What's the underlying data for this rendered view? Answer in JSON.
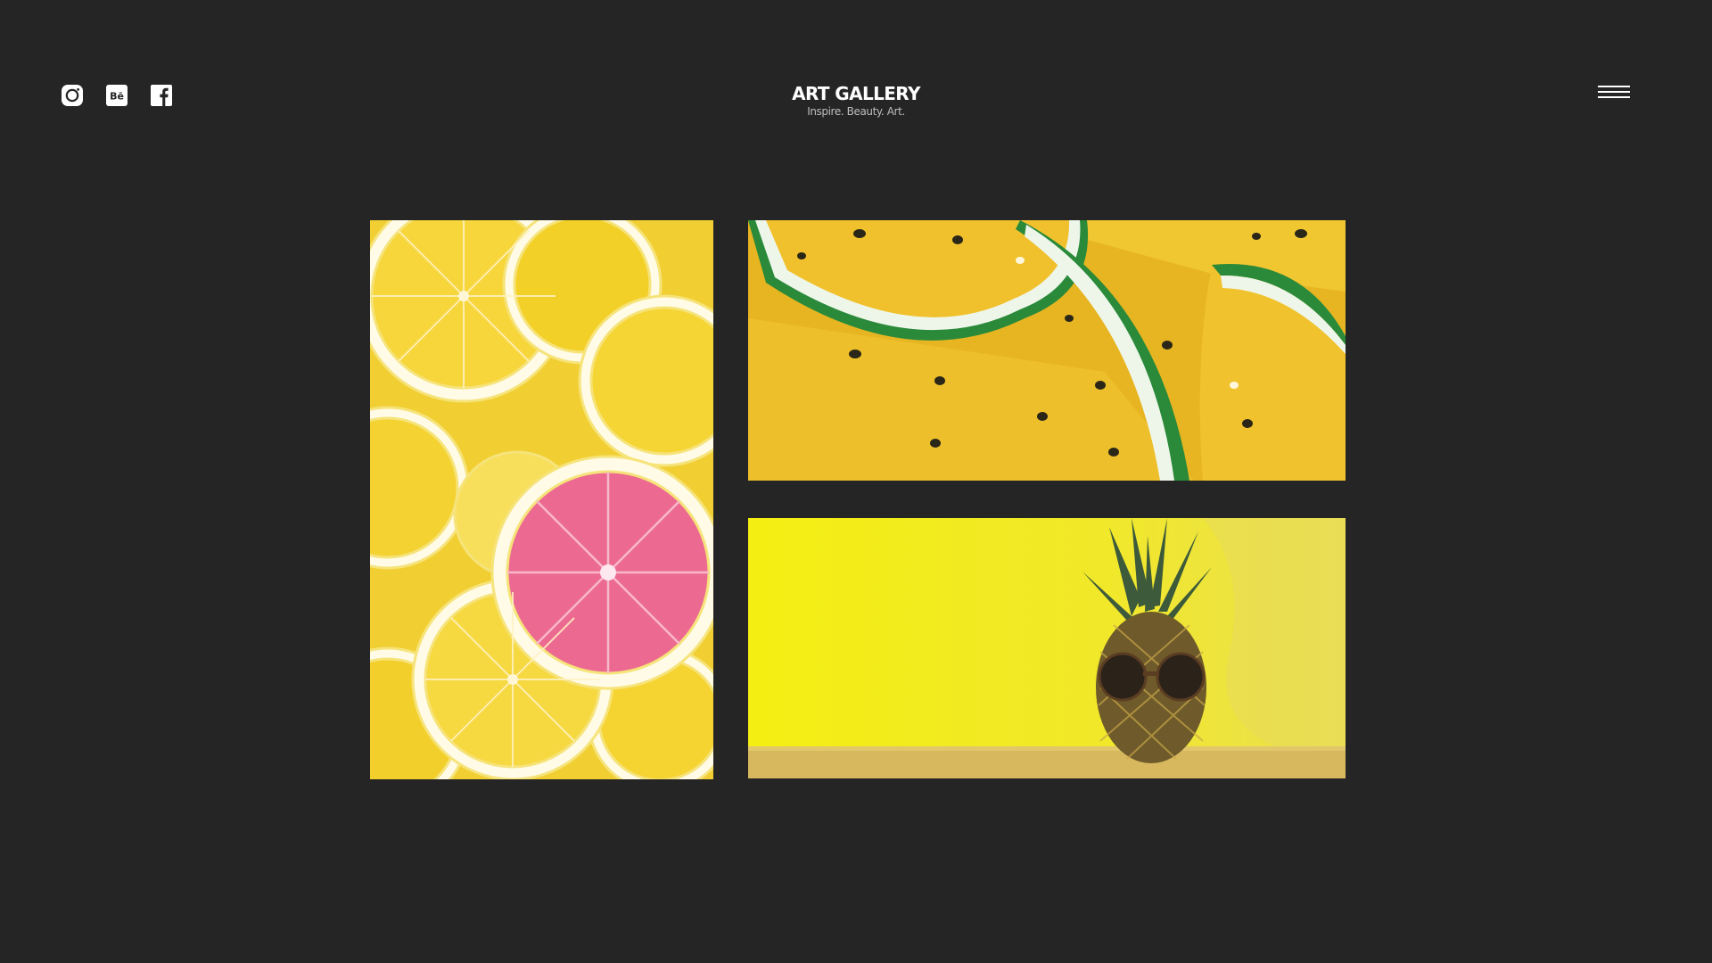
{
  "header": {
    "title": "ART GALLERY",
    "tagline": "Inspire. Beauty. Art.",
    "social": [
      {
        "icon": "instagram-icon"
      },
      {
        "icon": "behance-icon",
        "glyph": "Bē"
      },
      {
        "icon": "facebook-icon"
      }
    ],
    "menu_icon": "hamburger-menu-icon"
  },
  "gallery": {
    "tiles": [
      {
        "subject": "lemons-and-grapefruit",
        "dominant_color": "#f3d12a",
        "accent_color": "#ec6a91"
      },
      {
        "subject": "yellow-watermelon",
        "dominant_color": "#e9b923",
        "accent_color": "#2c8b3c"
      },
      {
        "subject": "pineapple-with-sunglasses",
        "dominant_color": "#f4ee1d",
        "accent_color": "#3f3a23"
      }
    ]
  },
  "colors": {
    "background": "#252525",
    "text_primary": "#ffffff",
    "text_secondary": "#bdbdbd"
  }
}
